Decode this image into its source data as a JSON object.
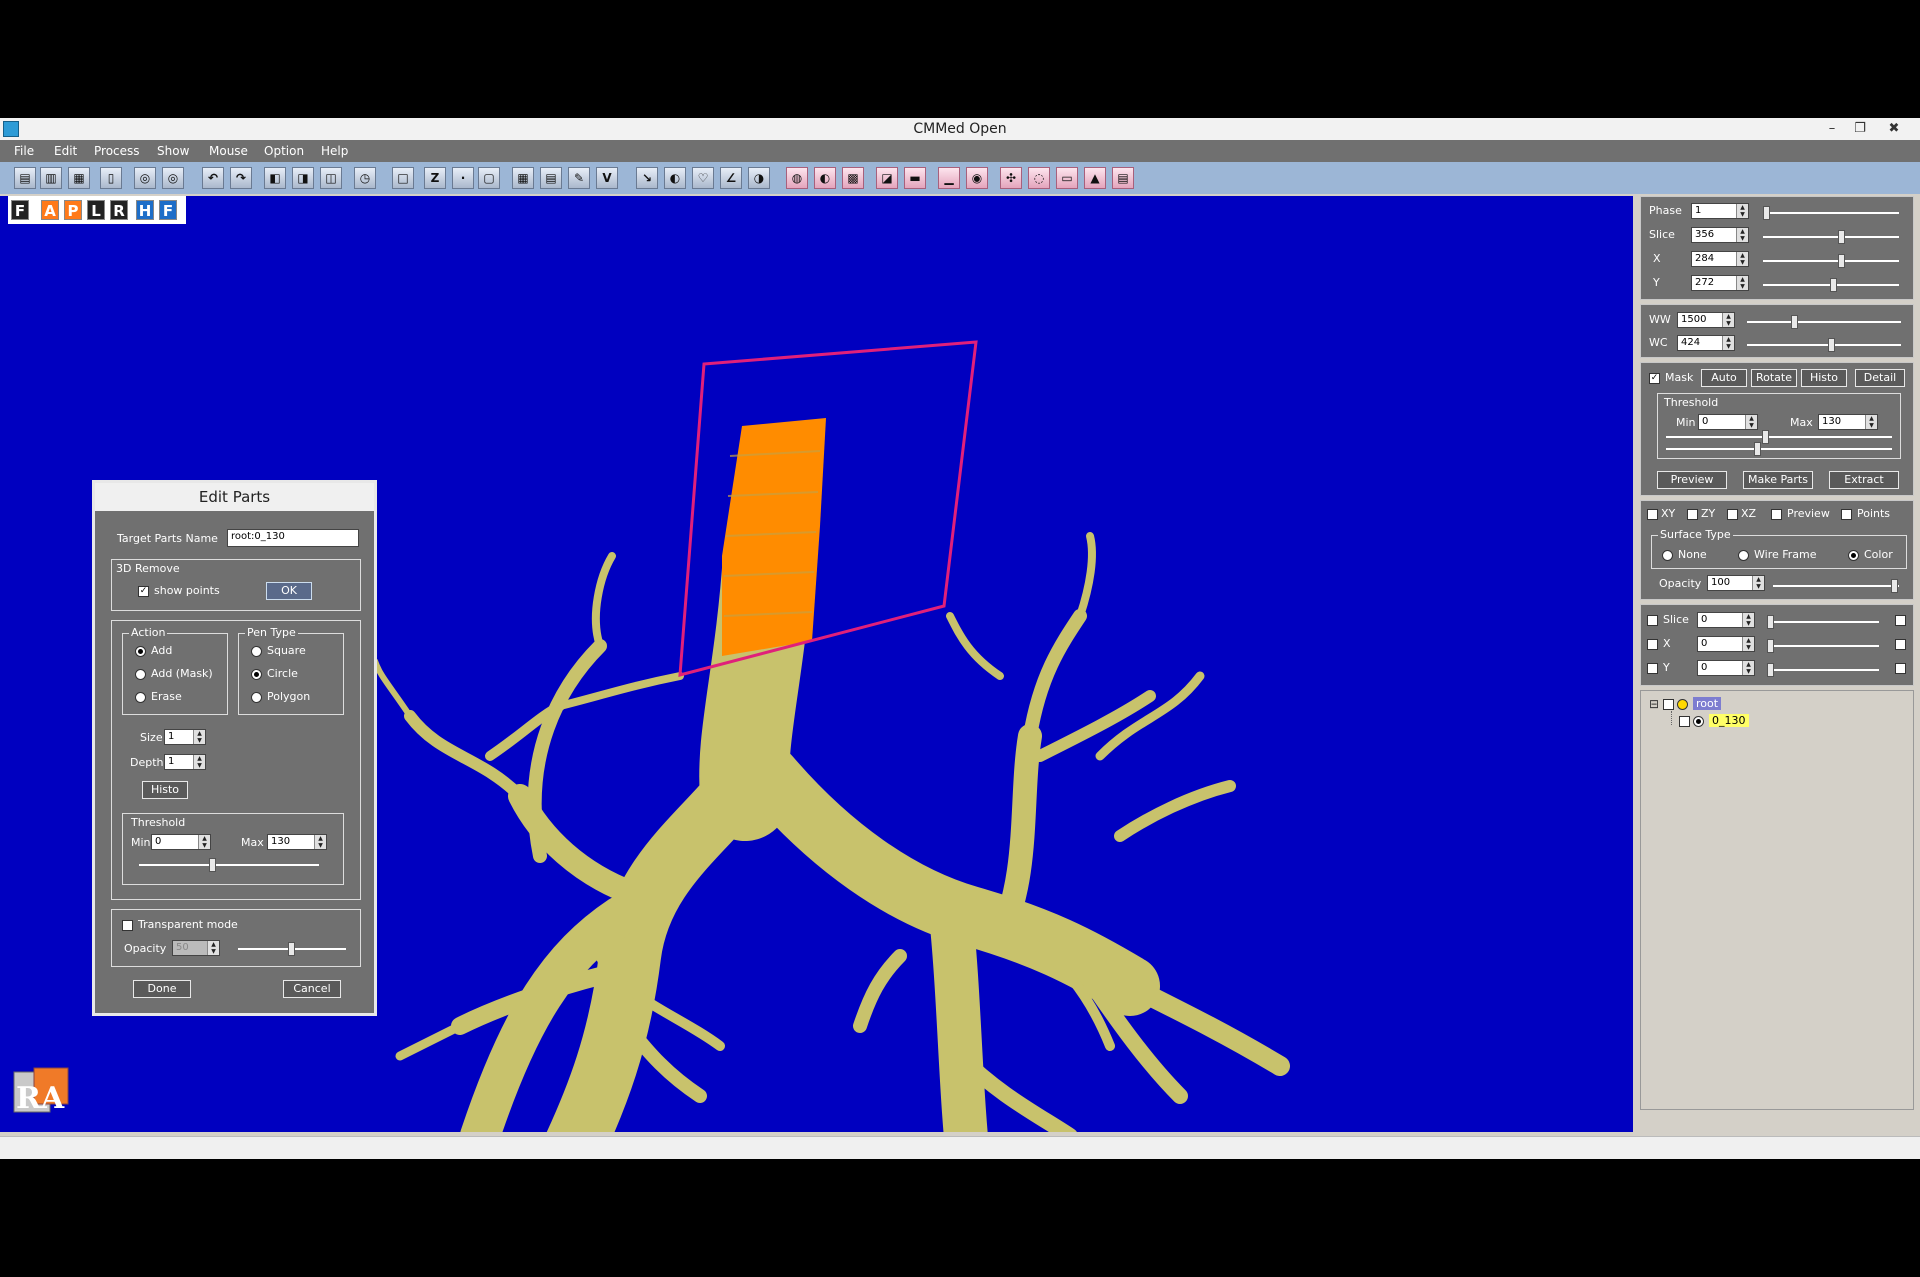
{
  "window": {
    "title": "CMMed  Open",
    "minimize": "–",
    "restore": "❐",
    "close": "✖"
  },
  "menu": [
    "File",
    "Edit",
    "Process",
    "Show",
    "Mouse",
    "Option",
    "Help"
  ],
  "orientation": {
    "labels": [
      "F",
      "A",
      "P",
      "L",
      "R",
      "H",
      "F"
    ]
  },
  "view": {
    "background": "#0000c0",
    "airway_color": "#c8c26c",
    "selected_color": "#ff8c00",
    "plane_color": "#e0207a",
    "logo_letters": "RA"
  },
  "slice_panel": {
    "phase": {
      "label": "Phase",
      "value": "1",
      "level": 0.0
    },
    "slice": {
      "label": "Slice",
      "value": "356",
      "level": 0.58
    },
    "x": {
      "label": "X",
      "value": "284",
      "level": 0.58
    },
    "y": {
      "label": "Y",
      "value": "272",
      "level": 0.52
    }
  },
  "window_panel": {
    "ww": {
      "label": "WW",
      "value": "1500",
      "level": 0.3
    },
    "wc": {
      "label": "WC",
      "value": "424",
      "level": 0.55
    }
  },
  "mask_panel": {
    "mask_label": "Mask",
    "mask_checked": true,
    "buttons": [
      "Auto",
      "Rotate",
      "Histo",
      "Detail"
    ],
    "threshold_title": "Threshold",
    "min_label": "Min",
    "min_value": "0",
    "max_label": "Max",
    "max_value": "130",
    "actions": [
      "Preview",
      "Make Parts",
      "Extract"
    ]
  },
  "surface_panel": {
    "checks": [
      "XY",
      "ZY",
      "XZ",
      "Preview",
      "Points"
    ],
    "surface_type_title": "Surface Type",
    "types": [
      "None",
      "Wire Frame",
      "Color"
    ],
    "selected_type": "Color",
    "opacity_label": "Opacity",
    "opacity_value": "100"
  },
  "clip_panel": {
    "slice": {
      "label": "Slice",
      "value": "0"
    },
    "x": {
      "label": "X",
      "value": "0"
    },
    "y": {
      "label": "Y",
      "value": "0"
    }
  },
  "tree": {
    "root": "root",
    "child": "0_130",
    "collapse_glyph": "⊟"
  },
  "edit_parts": {
    "title": "Edit Parts",
    "target_label": "Target Parts Name",
    "target_value": "root:0_130",
    "remove_title": "3D Remove",
    "show_points": "show points",
    "show_points_checked": true,
    "ok": "OK",
    "action_title": "Action",
    "actions": [
      "Add",
      "Add (Mask)",
      "Erase"
    ],
    "selected_action": "Add",
    "pen_title": "Pen Type",
    "pens": [
      "Square",
      "Circle",
      "Polygon"
    ],
    "selected_pen": "Circle",
    "size_label": "Size",
    "size_value": "1",
    "depth_label": "Depth",
    "depth_value": "1",
    "histo": "Histo",
    "threshold_title": "Threshold",
    "min_label": "Min",
    "min_value": "0",
    "max_label": "Max",
    "max_value": "130",
    "transparent_label": "Transparent mode",
    "transparent_checked": false,
    "opacity_label": "Opacity",
    "opacity_value": "50",
    "done": "Done",
    "cancel": "Cancel"
  }
}
